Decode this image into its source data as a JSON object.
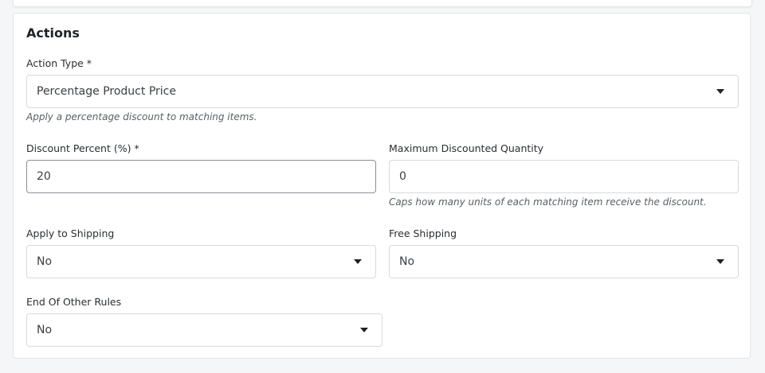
{
  "section": {
    "title": "Actions"
  },
  "action_type": {
    "label": "Action Type *",
    "value": "Percentage Product Price",
    "hint": "Apply a percentage discount to matching items."
  },
  "discount_percent": {
    "label": "Discount Percent (%) *",
    "value": "20"
  },
  "max_discounted_qty": {
    "label": "Maximum Discounted Quantity",
    "value": "0",
    "hint": "Caps how many units of each matching item receive the discount."
  },
  "apply_to_shipping": {
    "label": "Apply to Shipping",
    "value": "No"
  },
  "free_shipping": {
    "label": "Free Shipping",
    "value": "No"
  },
  "end_of_other_rules": {
    "label": "End Of Other Rules",
    "value": "No"
  },
  "icons": {
    "dropdown": "chevron-down-icon"
  }
}
